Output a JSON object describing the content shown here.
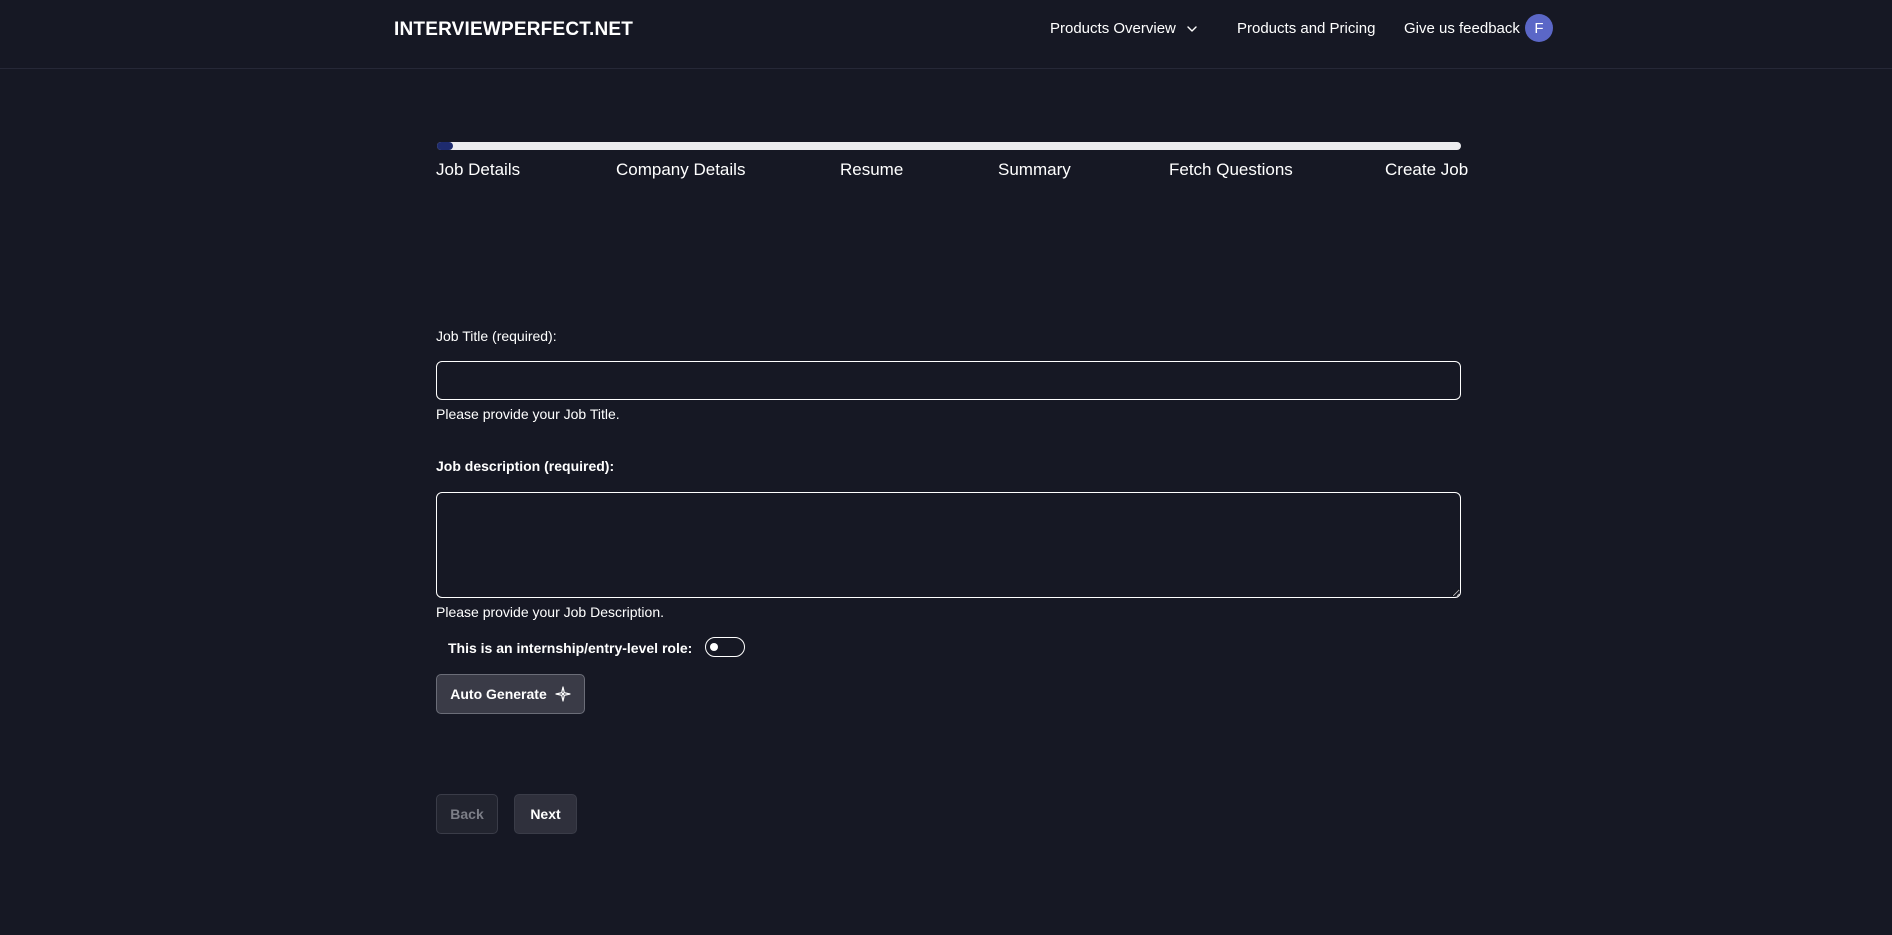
{
  "header": {
    "brand": "INTERVIEWPERFECT.NET",
    "nav": {
      "products_overview": "Products Overview",
      "products_pricing": "Products and Pricing",
      "feedback": "Give us feedback"
    },
    "avatar_initial": "F"
  },
  "stepper": {
    "progress": 0.01,
    "fill_color": "#1e2b6e",
    "track_color": "#ececef",
    "steps": [
      "Job Details",
      "Company Details",
      "Resume",
      "Summary",
      "Fetch Questions",
      "Create Job"
    ]
  },
  "form": {
    "job_title_label": "Job Title (required):",
    "job_title_value": "",
    "job_title_help": "Please provide your Job Title.",
    "job_description_label": "Job description (required):",
    "job_description_value": "",
    "job_description_help": "Please provide your Job Description.",
    "internship_label": "This is an internship/entry-level role:",
    "internship_toggle_on": false,
    "auto_generate_label": "Auto Generate"
  },
  "footer_buttons": {
    "back_label": "Back",
    "next_label": "Next"
  },
  "colors": {
    "background": "#161824",
    "avatar": "#5b67c7"
  },
  "icons": {
    "dropdown": "chevron-down-icon",
    "auto_generate": "sparkle-icon"
  }
}
